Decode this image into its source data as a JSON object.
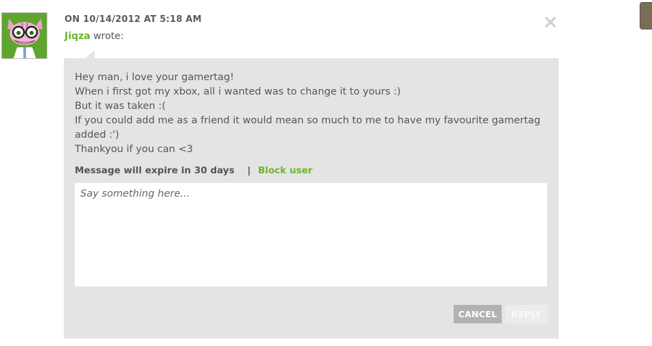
{
  "message": {
    "timestamp": "ON 10/14/2012 AT 5:18 AM",
    "author": "Jiqza",
    "wrote_label": "wrote:",
    "close_icon": "×",
    "body_lines": [
      "Hey man, i love your gamertag!",
      "When i first got my xbox, all i wanted was to change it to yours :)",
      "But it was taken :(",
      "If you could add me as a friend it would mean so much to me to have my favourite gamertag added :')",
      "Thankyou if you can <3"
    ],
    "expire_text": "Message will expire in 30 days",
    "separator": "|",
    "block_label": "Block user"
  },
  "reply": {
    "placeholder": "Say something here...",
    "cancel_label": "CANCEL",
    "reply_label": "REPLY"
  },
  "icons": {
    "avatar": "cat-avatar-icon",
    "close": "close-icon",
    "corner": "corner-thumbnail-icon"
  },
  "colors": {
    "accent_green": "#6cb42c",
    "bubble_bg": "#e4e4e4",
    "cancel_bg": "#b2b2b2",
    "reply_bg_disabled": "#ececec"
  }
}
